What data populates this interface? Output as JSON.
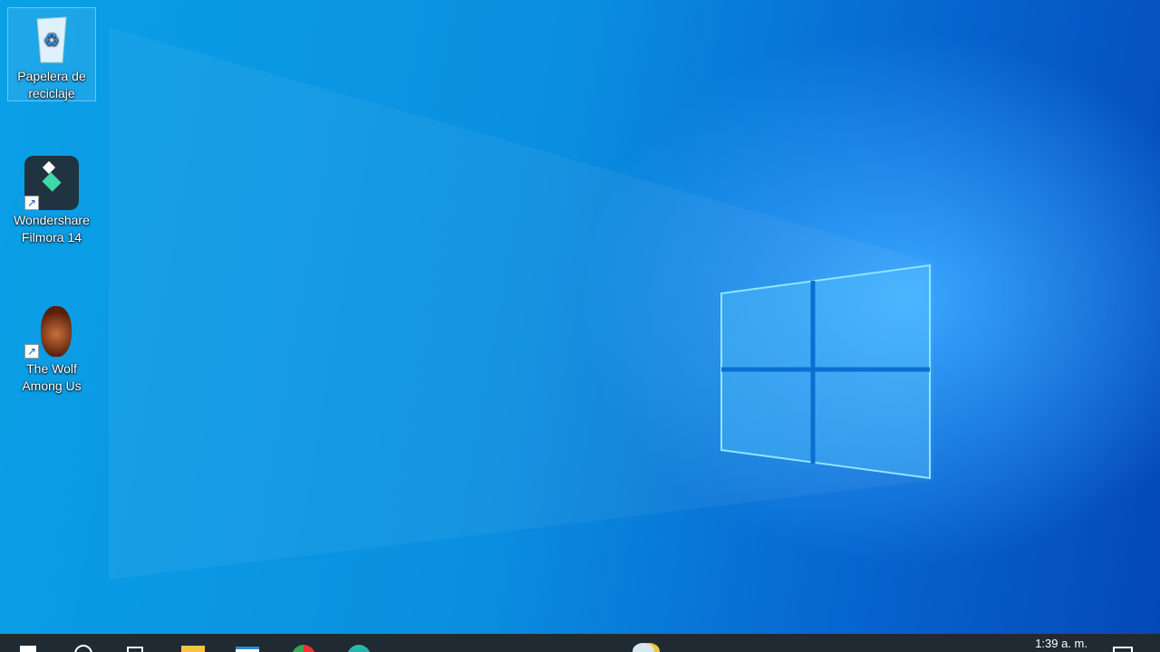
{
  "desktop": {
    "icons": [
      {
        "label_line1": "Papelera de",
        "label_line2": "reciclaje",
        "icon": "recycle-bin-icon"
      },
      {
        "label_line1": "Wondershare",
        "label_line2": "Filmora 14",
        "icon": "filmora-icon"
      },
      {
        "label_line1": "The Wolf",
        "label_line2": "Among Us",
        "icon": "wolf-among-us-icon"
      }
    ]
  },
  "taskbar": {
    "clock": "1:39 a. m.",
    "accent": "#1f2a33"
  }
}
